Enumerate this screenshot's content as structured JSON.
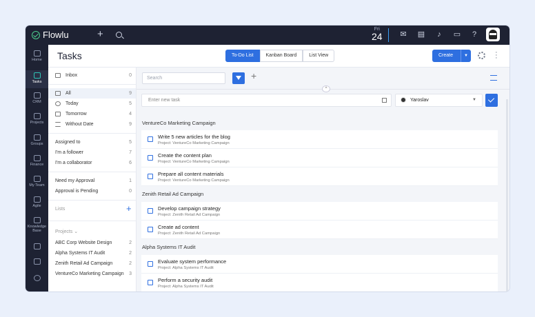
{
  "topbar": {
    "app_name": "Flowlu",
    "day_of_week": "Fri",
    "day": "24"
  },
  "sidebar": {
    "items": [
      {
        "label": "Home"
      },
      {
        "label": "Tasks"
      },
      {
        "label": "CRM"
      },
      {
        "label": "Projects"
      },
      {
        "label": "Groups"
      },
      {
        "label": "Finance"
      },
      {
        "label": "My Team"
      },
      {
        "label": "Agile"
      },
      {
        "label": "Knowledge"
      },
      {
        "label": "Base"
      }
    ]
  },
  "header": {
    "title": "Tasks",
    "views": [
      "To-Do List",
      "Kanban Board",
      "List View"
    ],
    "create_label": "Create"
  },
  "filters": {
    "inbox": {
      "label": "Inbox",
      "count": "0"
    },
    "all": {
      "label": "All",
      "count": "9"
    },
    "today": {
      "label": "Today",
      "count": "5"
    },
    "tomorrow": {
      "label": "Tomorrow",
      "count": "4"
    },
    "without_date": {
      "label": "Without Date",
      "count": "9"
    },
    "assigned": {
      "label": "Assigned to",
      "count": "5"
    },
    "follower": {
      "label": "I'm a follower",
      "count": "7"
    },
    "collaborator": {
      "label": "I'm a collaborator",
      "count": "6"
    },
    "need_approval": {
      "label": "Need my Approval",
      "count": "1"
    },
    "pending": {
      "label": "Approval is Pending",
      "count": "0"
    },
    "lists_label": "Lists",
    "projects_label": "Projects",
    "projects": [
      {
        "label": "ABC Corp Website Design",
        "count": "2"
      },
      {
        "label": "Alpha Systems IT Audit",
        "count": "2"
      },
      {
        "label": "Zenith Retail Ad Campaign",
        "count": "2"
      },
      {
        "label": "VentureCo Marketing Campaign",
        "count": "3"
      }
    ]
  },
  "main": {
    "search_placeholder": "Search",
    "new_task_placeholder": "Enter new task",
    "assignee": "Yaroslav",
    "groups": [
      {
        "title": "VentureCo Marketing Campaign",
        "tasks": [
          {
            "title": "Write 5 new articles for the blog",
            "project": "Project: VentureCo Marketing Campaign"
          },
          {
            "title": "Create the content plan",
            "project": "Project: VentureCo Marketing Campaign"
          },
          {
            "title": "Prepare all content materials",
            "project": "Project: VentureCo Marketing Campaign"
          }
        ]
      },
      {
        "title": "Zenith Retail Ad Campaign",
        "tasks": [
          {
            "title": "Develop campaign strategy",
            "project": "Project: Zenith Retail Ad Campaign"
          },
          {
            "title": "Create ad content",
            "project": "Project: Zenith Retail Ad Campaign"
          }
        ]
      },
      {
        "title": "Alpha Systems IT Audit",
        "tasks": [
          {
            "title": "Evaluate system performance",
            "project": "Project: Alpha Systems IT Audit"
          },
          {
            "title": "Perform a security audit",
            "project": "Project: Alpha Systems IT Audit"
          }
        ]
      }
    ]
  }
}
